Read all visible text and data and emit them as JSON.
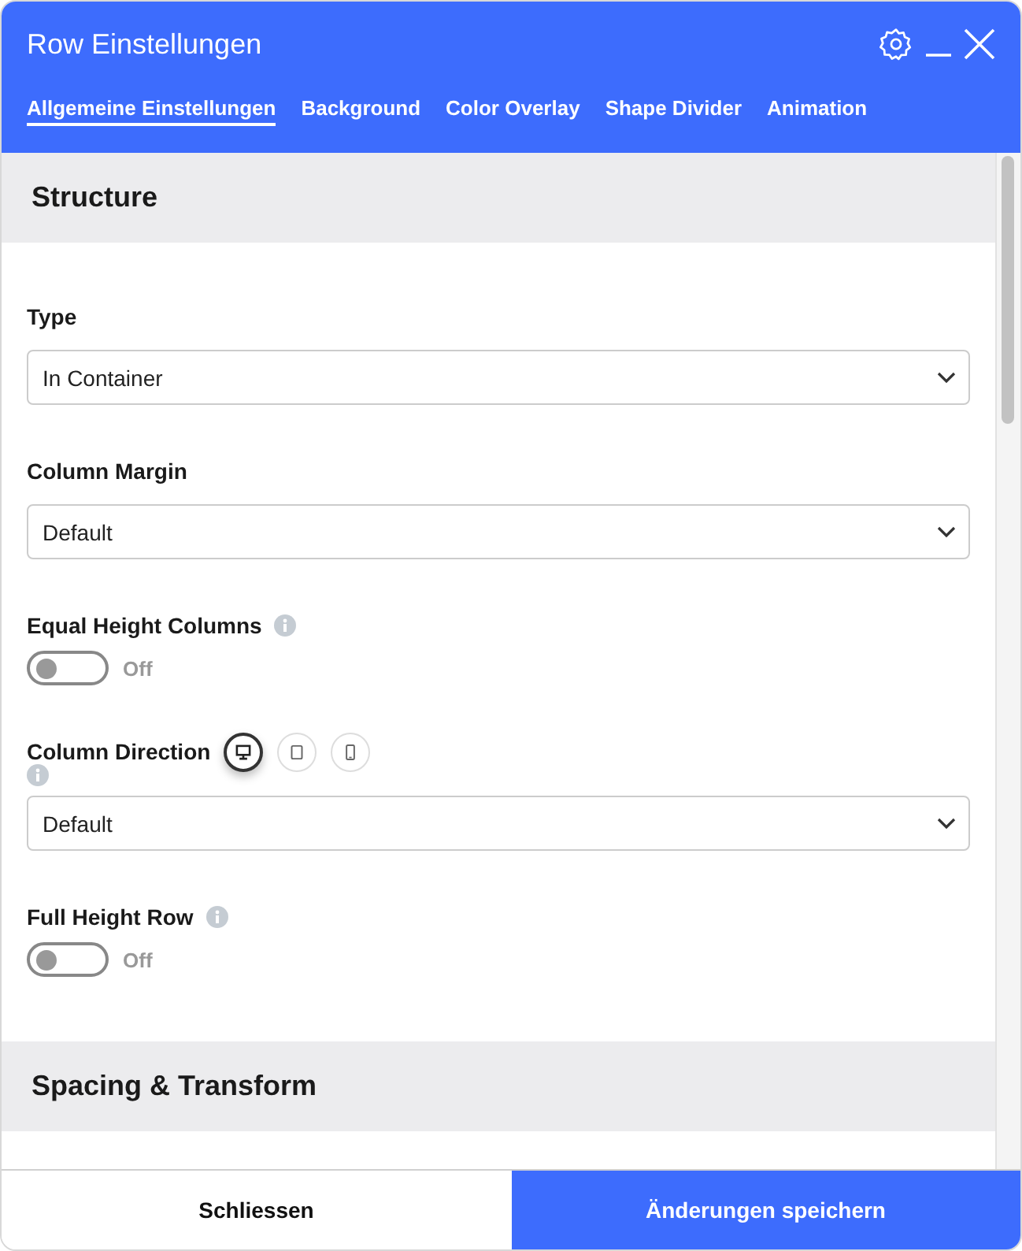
{
  "window": {
    "title": "Row Einstellungen"
  },
  "tabs": [
    {
      "label": "Allgemeine Einstellungen",
      "selected": true
    },
    {
      "label": "Background",
      "selected": false
    },
    {
      "label": "Color Overlay",
      "selected": false
    },
    {
      "label": "Shape Divider",
      "selected": false
    },
    {
      "label": "Animation",
      "selected": false
    }
  ],
  "sections": [
    {
      "title": "Structure",
      "fields": [
        {
          "kind": "select",
          "label": "Type",
          "value": "In Container"
        },
        {
          "kind": "select",
          "label": "Column Margin",
          "value": "Default"
        },
        {
          "kind": "toggle",
          "label": "Equal Height Columns",
          "info": true,
          "on": false,
          "state_label": "Off"
        },
        {
          "kind": "select",
          "label": "Column Direction",
          "info": true,
          "devices": [
            {
              "kind": "desktop",
              "selected": true
            },
            {
              "kind": "tablet",
              "selected": false
            },
            {
              "kind": "phone",
              "selected": false
            }
          ],
          "value": "Default"
        },
        {
          "kind": "toggle",
          "label": "Full Height Row",
          "info": true,
          "on": false,
          "state_label": "Off"
        }
      ]
    },
    {
      "title": "Spacing & Transform"
    }
  ],
  "footer": {
    "buttons": [
      {
        "label": "Schliessen",
        "kind": "secondary"
      },
      {
        "label": "Änderungen speichern",
        "kind": "primary"
      }
    ]
  }
}
